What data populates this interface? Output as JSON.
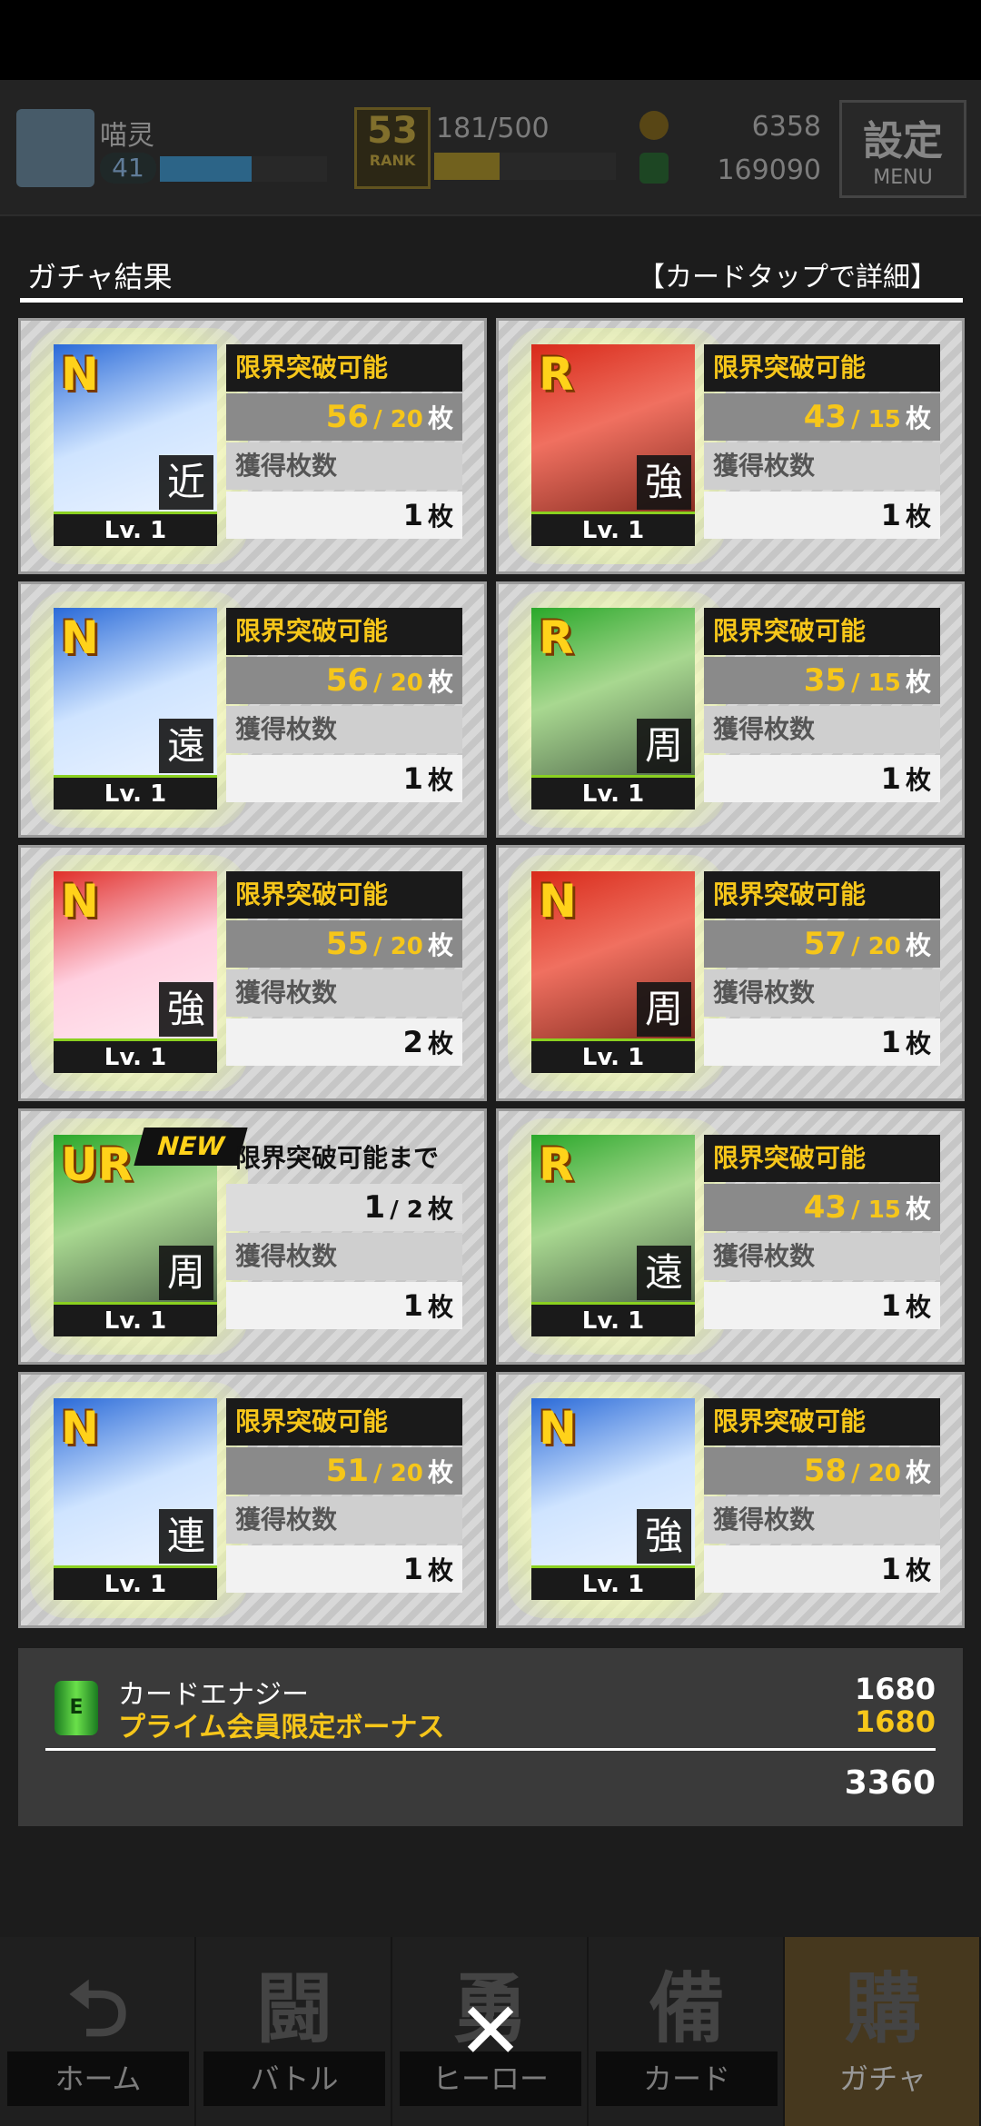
{
  "header": {
    "player_name": "喵灵",
    "player_level": "41",
    "exp_fraction": 0.55,
    "rank": "53",
    "rank_label": "RANK",
    "stamina": "181/500",
    "stamina_fraction": 0.36,
    "coins": "6358",
    "energy": "169090",
    "menu_big": "設定",
    "menu_small": "MENU"
  },
  "section": {
    "title": "ガチャ結果",
    "hint": "【カードタップで詳細】"
  },
  "cards": [
    {
      "rarity": "N",
      "kanji": "近",
      "lv": "Lv. 1",
      "status": "限界突破可能",
      "count_a": "56",
      "count_b": "/ 20",
      "unit": "枚",
      "owned_label": "獲得枚数",
      "owned": "1",
      "new": false,
      "theme": "blue"
    },
    {
      "rarity": "R",
      "kanji": "強",
      "lv": "Lv. 1",
      "status": "限界突破可能",
      "count_a": "43",
      "count_b": "/ 15",
      "unit": "枚",
      "owned_label": "獲得枚数",
      "owned": "1",
      "new": false,
      "theme": "red"
    },
    {
      "rarity": "N",
      "kanji": "遠",
      "lv": "Lv. 1",
      "status": "限界突破可能",
      "count_a": "56",
      "count_b": "/ 20",
      "unit": "枚",
      "owned_label": "獲得枚数",
      "owned": "1",
      "new": false,
      "theme": "blue"
    },
    {
      "rarity": "R",
      "kanji": "周",
      "lv": "Lv. 1",
      "status": "限界突破可能",
      "count_a": "35",
      "count_b": "/ 15",
      "unit": "枚",
      "owned_label": "獲得枚数",
      "owned": "1",
      "new": false,
      "theme": "green"
    },
    {
      "rarity": "N",
      "kanji": "強",
      "lv": "Lv. 1",
      "status": "限界突破可能",
      "count_a": "55",
      "count_b": "/ 20",
      "unit": "枚",
      "owned_label": "獲得枚数",
      "owned": "2",
      "new": false,
      "theme": "pink"
    },
    {
      "rarity": "N",
      "kanji": "周",
      "lv": "Lv. 1",
      "status": "限界突破可能",
      "count_a": "57",
      "count_b": "/ 20",
      "unit": "枚",
      "owned_label": "獲得枚数",
      "owned": "1",
      "new": false,
      "theme": "red"
    },
    {
      "rarity": "UR",
      "kanji": "周",
      "lv": "Lv. 1",
      "status": "限界突破可能まで",
      "count_a": "1",
      "count_b": "/ 2",
      "unit": "枚",
      "owned_label": "獲得枚数",
      "owned": "1",
      "new": true,
      "new_label": "NEW",
      "theme": "green"
    },
    {
      "rarity": "R",
      "kanji": "遠",
      "lv": "Lv. 1",
      "status": "限界突破可能",
      "count_a": "43",
      "count_b": "/ 15",
      "unit": "枚",
      "owned_label": "獲得枚数",
      "owned": "1",
      "new": false,
      "theme": "green"
    },
    {
      "rarity": "N",
      "kanji": "連",
      "lv": "Lv. 1",
      "status": "限界突破可能",
      "count_a": "51",
      "count_b": "/ 20",
      "unit": "枚",
      "owned_label": "獲得枚数",
      "owned": "1",
      "new": false,
      "theme": "blue"
    },
    {
      "rarity": "N",
      "kanji": "強",
      "lv": "Lv. 1",
      "status": "限界突破可能",
      "count_a": "58",
      "count_b": "/ 20",
      "unit": "枚",
      "owned_label": "獲得枚数",
      "owned": "1",
      "new": false,
      "theme": "blue"
    }
  ],
  "summary": {
    "icon_label": "E",
    "line1_label": "カードエナジー",
    "line1_value": "1680",
    "line2_label": "プライム会員限定ボーナス",
    "line2_value": "1680",
    "total": "3360"
  },
  "nav": [
    {
      "label": "ホーム",
      "glyph": "⮌",
      "active": false
    },
    {
      "label": "バトル",
      "glyph": "闘",
      "active": false
    },
    {
      "label": "ヒーロー",
      "glyph": "勇",
      "active": false
    },
    {
      "label": "カード",
      "glyph": "備",
      "active": false
    },
    {
      "label": "ガチャ",
      "glyph": "購",
      "active": true
    }
  ],
  "close_label": "✕",
  "colors": {
    "accent_yellow": "#f6c61a",
    "glow": "#f0ffa0",
    "lv_border": "#8ad020"
  }
}
